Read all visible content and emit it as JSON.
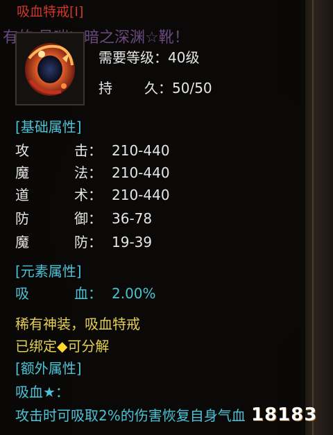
{
  "item": {
    "title": "吸血特戒[I]",
    "background_text": "有的   号喘い暗之深渊☆靴！",
    "icon": "red-ring-icon",
    "required_level_label": "需要等级：",
    "required_level_value": "40级",
    "durability_label": "持",
    "durability_label2": "久：",
    "durability_value": "50/50"
  },
  "sections": {
    "base": "[基础属性]",
    "element": "[元素属性]",
    "extra": "[额外属性]"
  },
  "base_stats": [
    {
      "c1": "攻",
      "c2": "击：",
      "value": "210-440"
    },
    {
      "c1": "魔",
      "c2": "法：",
      "value": "210-440"
    },
    {
      "c1": "道",
      "c2": "术：",
      "value": "210-440"
    },
    {
      "c1": "防",
      "c2": "御：",
      "value": "36-78"
    },
    {
      "c1": "魔",
      "c2": "防：",
      "value": "19-39"
    }
  ],
  "element_stats": [
    {
      "c1": "吸",
      "c2": "血：",
      "value": "2.00%"
    }
  ],
  "flags": {
    "rare": "稀有神装，吸血特戒",
    "bound_prefix": "已绑定",
    "bound_suffix": "可分解"
  },
  "extra": {
    "name": "吸血★：",
    "desc": "攻击时可吸取2%的伤害恢复自身气血"
  },
  "watermark": {
    "text": "18183"
  },
  "colors": {
    "title": "#d0362c",
    "cyan": "#4bc3d6",
    "yellow": "#e3d050",
    "white": "#e6e6e6"
  }
}
